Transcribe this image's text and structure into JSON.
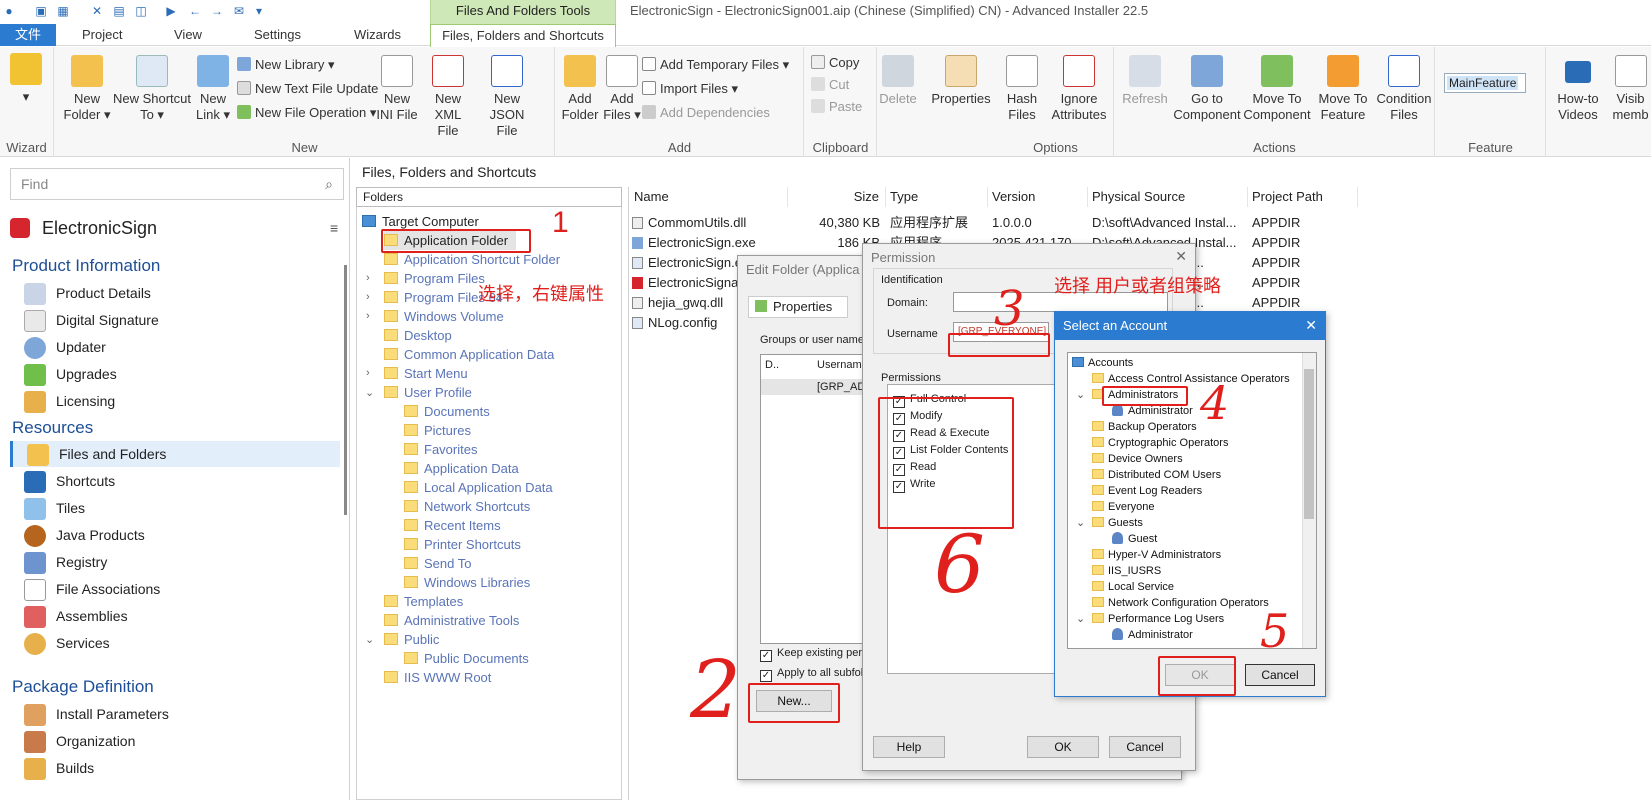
{
  "window": {
    "title": "ElectronicSign - ElectronicSign001.aip (Chinese (Simplified) CN) - Advanced Installer 22.5",
    "context_tab_header": "Files And Folders Tools"
  },
  "tabs": [
    "文件",
    "Project",
    "View",
    "Settings",
    "Wizards",
    "Files, Folders and Shortcuts"
  ],
  "ribbon": {
    "wizard_group": "Wizard",
    "new_group": {
      "label": "New",
      "new_folder": "New Folder",
      "new_shortcut_to": "New Shortcut To",
      "new_link": "New Link",
      "new_library": "New Library",
      "new_text_file_update": "New Text File Update",
      "new_file_operation": "New File Operation",
      "new_ini_file": "New INI File",
      "new_xml_file": "New XML File",
      "new_json_file": "New JSON File"
    },
    "add_group": {
      "label": "Add",
      "add_folder": "Add Folder",
      "add_files": "Add Files",
      "add_temporary_files": "Add Temporary Files",
      "import_files": "Import Files",
      "add_dependencies": "Add Dependencies"
    },
    "clipboard_group": {
      "label": "Clipboard",
      "copy": "Copy",
      "cut": "Cut",
      "paste": "Paste"
    },
    "delete": "Delete",
    "properties": "Properties",
    "options_group": {
      "label": "Options",
      "hash_files": "Hash Files",
      "ignore_attributes": "Ignore Attributes"
    },
    "actions_group": {
      "label": "Actions",
      "refresh": "Refresh",
      "go_to_component": "Go to Component",
      "move_to_component": "Move To Component",
      "move_to_feature": "Move To Feature",
      "condition_files": "Condition Files"
    },
    "feature_group": {
      "label": "Feature",
      "value": "MainFeature"
    },
    "how_to_videos": "How-to Videos",
    "visible_members": "Visib memb"
  },
  "sidebar": {
    "search_placeholder": "Find",
    "project_name": "ElectronicSign",
    "sections": [
      {
        "title": "Product Information",
        "items": [
          "Product Details",
          "Digital Signature",
          "Updater",
          "Upgrades",
          "Licensing"
        ]
      },
      {
        "title": "Resources",
        "items": [
          "Files and Folders",
          "Shortcuts",
          "Tiles",
          "Java Products",
          "Registry",
          "File Associations",
          "Assemblies",
          "Services"
        ]
      },
      {
        "title": "Package Definition",
        "items": [
          "Install Parameters",
          "Organization",
          "Builds"
        ]
      }
    ],
    "selected": "Files and Folders"
  },
  "main": {
    "header": "Files, Folders and Shortcuts",
    "folders_header": "Folders",
    "folders": [
      "Target Computer",
      "Application Folder",
      "Application Shortcut Folder",
      "Program Files",
      "Program Files 64",
      "Windows Volume",
      "Desktop",
      "Common Application Data",
      "Start Menu",
      "User Profile",
      "Documents",
      "Pictures",
      "Favorites",
      "Application Data",
      "Local Application Data",
      "Network Shortcuts",
      "Recent Items",
      "Printer Shortcuts",
      "Send To",
      "Windows Libraries",
      "Templates",
      "Administrative Tools",
      "Public",
      "Public Documents",
      "IIS WWW Root"
    ],
    "file_columns": [
      "Name",
      "Size",
      "Type",
      "Version",
      "Physical Source",
      "Project Path"
    ],
    "files": [
      {
        "name": "CommomUtils.dll",
        "size": "40,380 KB",
        "type": "应用程序扩展",
        "version": "1.0.0.0",
        "source": "D:\\soft\\Advanced Instal...",
        "path": "APPDIR"
      },
      {
        "name": "ElectronicSign.exe",
        "size": "186 KB",
        "type": "应用程序",
        "version": "2025.421.170",
        "source": "D:\\soft\\Advanced Instal...",
        "path": "APPDIR"
      },
      {
        "name": "ElectronicSign.e",
        "size": "",
        "type": "",
        "version": "",
        "source": "Instal...",
        "path": "APPDIR"
      },
      {
        "name": "ElectronicSigna",
        "size": "",
        "type": "",
        "version": "",
        "source": "Instal...",
        "path": "APPDIR"
      },
      {
        "name": "hejia_gwq.dll",
        "size": "",
        "type": "",
        "version": "",
        "source": "Instal...",
        "path": "APPDIR"
      },
      {
        "name": "NLog.config",
        "size": "",
        "type": "",
        "version": "",
        "source": "",
        "path": ""
      }
    ]
  },
  "edit_folder_dialog": {
    "title": "Edit Folder (Applica",
    "tab_properties": "Properties",
    "groups_label": "Groups or user names",
    "col_d": "D..",
    "col_username": "Username",
    "row_username": "[GRP_AD",
    "keep_existing": "Keep existing perm",
    "apply_subfolders": "Apply to all subfold",
    "new_button": "New..."
  },
  "permission_dialog": {
    "title": "Permission",
    "identification": "Identification",
    "domain_label": "Domain:",
    "domain_value": "",
    "username_label": "Username",
    "username_value": "[GRP_EVERYONE]",
    "permissions_label": "Permissions",
    "permissions": [
      "Full Control",
      "Modify",
      "Read & Execute",
      "List Folder Contents",
      "Read",
      "Write"
    ],
    "help": "Help",
    "ok": "OK",
    "cancel": "Cancel"
  },
  "select_account_dialog": {
    "title": "Select an Account",
    "accounts": [
      "Accounts",
      "Access Control Assistance Operators",
      "Administrators",
      "Administrator",
      "Backup Operators",
      "Cryptographic Operators",
      "Device Owners",
      "Distributed COM Users",
      "Event Log Readers",
      "Everyone",
      "Guests",
      "Guest",
      "Hyper-V Administrators",
      "IIS_IUSRS",
      "Local Service",
      "Network Configuration Operators",
      "Performance Log Users",
      "Administrator"
    ],
    "ok": "OK",
    "cancel": "Cancel"
  },
  "annotations": {
    "step1_text": "选择，右键属性",
    "step3_text": "选择 用户或者组策略",
    "n1": "1",
    "n2": "2",
    "n3": "3",
    "n4": "4",
    "n5": "5",
    "n6": "6"
  },
  "colors": {
    "accent": "#2b7bd0",
    "context_tab": "#cfe8b8",
    "annotation_red": "#e0201c",
    "nav_section": "#1d4e96"
  }
}
